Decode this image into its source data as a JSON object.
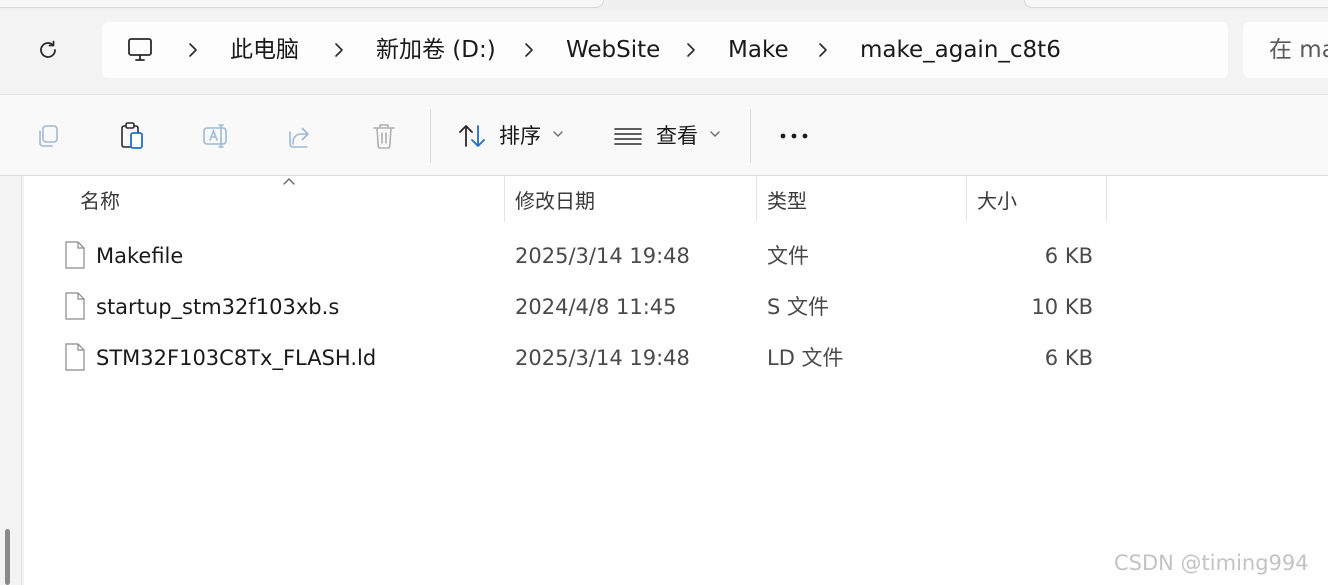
{
  "breadcrumb": {
    "items": [
      "此电脑",
      "新加卷 (D:)",
      "WebSite",
      "Make",
      "make_again_c8t6"
    ]
  },
  "search": {
    "placeholder": "在 ma"
  },
  "toolbar": {
    "sort_label": "排序",
    "view_label": "查看"
  },
  "columns": {
    "name": "名称",
    "modified": "修改日期",
    "type": "类型",
    "size": "大小"
  },
  "files": [
    {
      "name": "Makefile",
      "modified": "2025/3/14 19:48",
      "type": "文件",
      "size": "6 KB"
    },
    {
      "name": "startup_stm32f103xb.s",
      "modified": "2024/4/8 11:45",
      "type": "S 文件",
      "size": "10 KB"
    },
    {
      "name": "STM32F103C8Tx_FLASH.ld",
      "modified": "2025/3/14 19:48",
      "type": "LD 文件",
      "size": "6 KB"
    }
  ],
  "watermark": "CSDN @timing994",
  "colors": {
    "accent": "#1f6fc5",
    "disabled_icon": "#9db9d8"
  }
}
